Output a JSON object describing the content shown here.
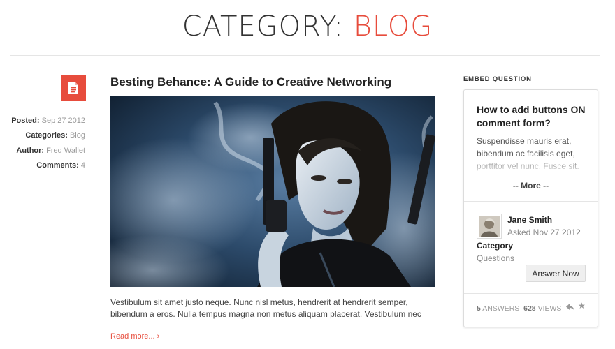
{
  "header": {
    "title_dark": "CATEGORY:",
    "title_accent": "BLOG"
  },
  "post": {
    "title": "Besting Behance: A Guide to Creative Networking",
    "icon": "document-icon",
    "meta": [
      {
        "label": "Posted:",
        "value": "Sep 27 2012"
      },
      {
        "label": "Categories:",
        "value": "Blog"
      },
      {
        "label": "Author:",
        "value": "Fred Wallet"
      },
      {
        "label": "Comments:",
        "value": "4"
      }
    ],
    "excerpt": "Vestibulum sit amet justo neque. Nunc nisl metus, hendrerit at hendrerit semper, bibendum a eros. Nulla tempus magna non metus aliquam placerat. Vestibulum nec",
    "read_more": "Read more... ›"
  },
  "sidebar": {
    "heading": "EMBED QUESTION",
    "question_title": "How to add buttons ON comment form?",
    "question_text": "Suspendisse mauris erat, bibendum ac facilisis eget, porttitor vel nunc. Fusce sit.",
    "more": "-- More --",
    "author_name": "Jane Smith",
    "asked": "Asked Nov 27 2012",
    "category_label": "Category",
    "category_value": "Questions",
    "answer_button": "Answer Now",
    "answers_count": "5",
    "answers_label": "ANSWERS",
    "views_count": "628",
    "views_label": "VIEWS"
  },
  "colors": {
    "accent": "#e74c3c",
    "text": "#333333",
    "muted": "#999999"
  }
}
